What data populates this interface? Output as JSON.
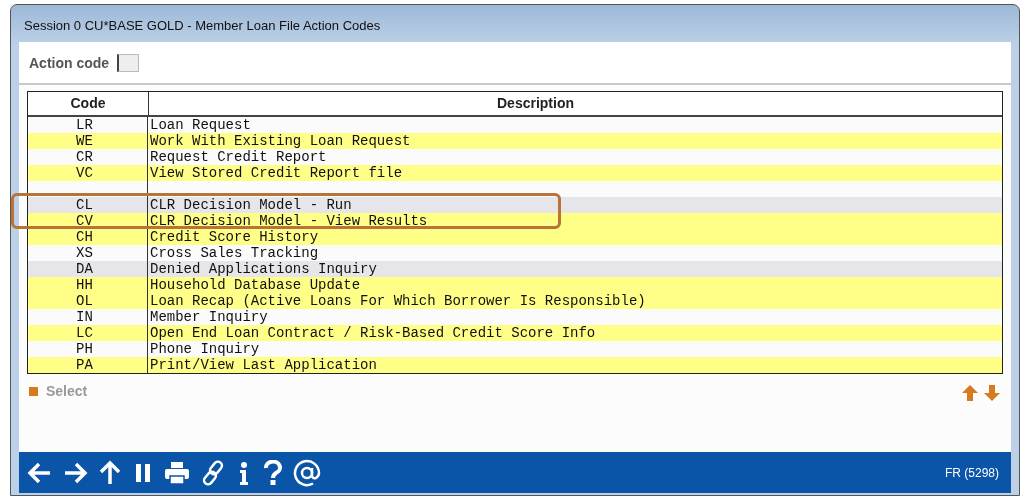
{
  "window": {
    "title": "Session 0 CU*BASE GOLD - Member Loan File Action Codes"
  },
  "action_code": {
    "label": "Action code"
  },
  "table": {
    "columns": [
      "Code",
      "Description"
    ],
    "rows": [
      {
        "code": "LR",
        "description": "Loan Request",
        "kind": "plain"
      },
      {
        "code": "WE",
        "description": "Work With Existing Loan Request",
        "kind": "highlighted"
      },
      {
        "code": "CR",
        "description": "Request Credit Report",
        "kind": "plain"
      },
      {
        "code": "VC",
        "description": "View Stored Credit Report file",
        "kind": "highlighted"
      },
      {
        "kind": "blank"
      },
      {
        "code": "CL",
        "description": "CLR Decision Model - Run",
        "kind": "shaded"
      },
      {
        "code": "CV",
        "description": "CLR Decision Model - View Results",
        "kind": "highlighted"
      },
      {
        "code": "CH",
        "description": "Credit Score History",
        "kind": "highlighted"
      },
      {
        "code": "XS",
        "description": "Cross Sales Tracking",
        "kind": "plain"
      },
      {
        "code": "DA",
        "description": "Denied Applications Inquiry",
        "kind": "shaded"
      },
      {
        "code": "HH",
        "description": "Household Database Update",
        "kind": "highlighted"
      },
      {
        "code": "OL",
        "description": "Loan Recap (Active Loans For Which Borrower Is Responsible)",
        "kind": "highlighted"
      },
      {
        "code": "IN",
        "description": "Member Inquiry",
        "kind": "plain"
      },
      {
        "code": "LC",
        "description": "Open End Loan Contract / Risk-Based Credit Score Info",
        "kind": "highlighted"
      },
      {
        "code": "PH",
        "description": "Phone Inquiry",
        "kind": "plain"
      },
      {
        "code": "PA",
        "description": "Print/View Last Application",
        "kind": "highlighted"
      }
    ]
  },
  "select_action": {
    "label": "Select",
    "disabled": true
  },
  "status_bar": {
    "screen_id": "FR (5298)"
  }
}
